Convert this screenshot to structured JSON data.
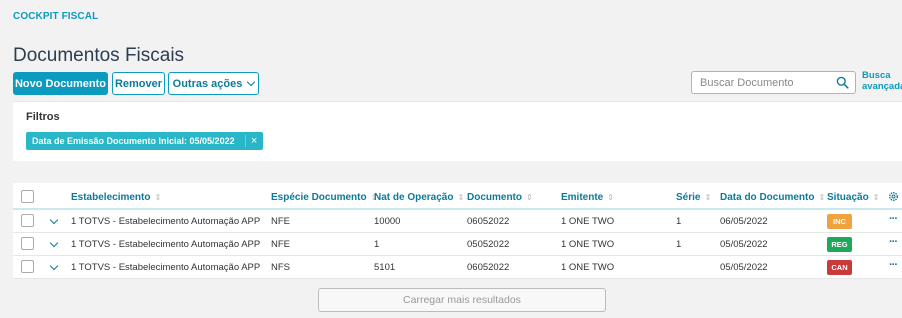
{
  "breadcrumb": "COCKPIT FISCAL",
  "page_title": "Documentos Fiscais",
  "toolbar": {
    "new_label": "Novo Documento",
    "remove_label": "Remover",
    "more_label": "Outras ações"
  },
  "search": {
    "placeholder": "Buscar Documento",
    "advanced_line1": "Busca",
    "advanced_line2": "avançada"
  },
  "filters": {
    "title": "Filtros",
    "tag": "Data de Emissão Documento Inicial: 05/05/2022",
    "tag_close": "×"
  },
  "table": {
    "sort_icon": "⇕",
    "columns": {
      "establishment": "Estabelecimento",
      "species": "Espécie Documento",
      "nat_op": "Nat de Operação",
      "document": "Documento",
      "issuer": "Emitente",
      "series": "Série",
      "doc_date": "Data do Documento",
      "status": "Situação"
    },
    "rows": [
      {
        "establishment": "1 TOTVS - Estabelecimento Automação APP",
        "species": "NFE",
        "nat_op": "10000",
        "document": "06052022",
        "issuer": "1 ONE TWO",
        "series": "1",
        "doc_date": "06/05/2022",
        "status": "INC",
        "status_color": "#f0a23c"
      },
      {
        "establishment": "1 TOTVS - Estabelecimento Automação APP",
        "species": "NFE",
        "nat_op": "1",
        "document": "05052022",
        "issuer": "1 ONE TWO",
        "series": "1",
        "doc_date": "05/05/2022",
        "status": "REG",
        "status_color": "#1ea85a"
      },
      {
        "establishment": "1 TOTVS - Estabelecimento Automação APP",
        "species": "NFS",
        "nat_op": "5101",
        "document": "06052022",
        "issuer": "1 ONE TWO",
        "series": "",
        "doc_date": "05/05/2022",
        "status": "CAN",
        "status_color": "#c93a3a"
      }
    ],
    "row_actions": "···"
  },
  "load_more": "Carregar mais resultados",
  "colors": {
    "accent": "#0c9abe",
    "filter_tag": "#29b6c8"
  },
  "icons": {
    "search": "search-icon",
    "settings": "gear-icon",
    "expand": "chevron-down-icon",
    "more": "chevron-down-icon"
  }
}
